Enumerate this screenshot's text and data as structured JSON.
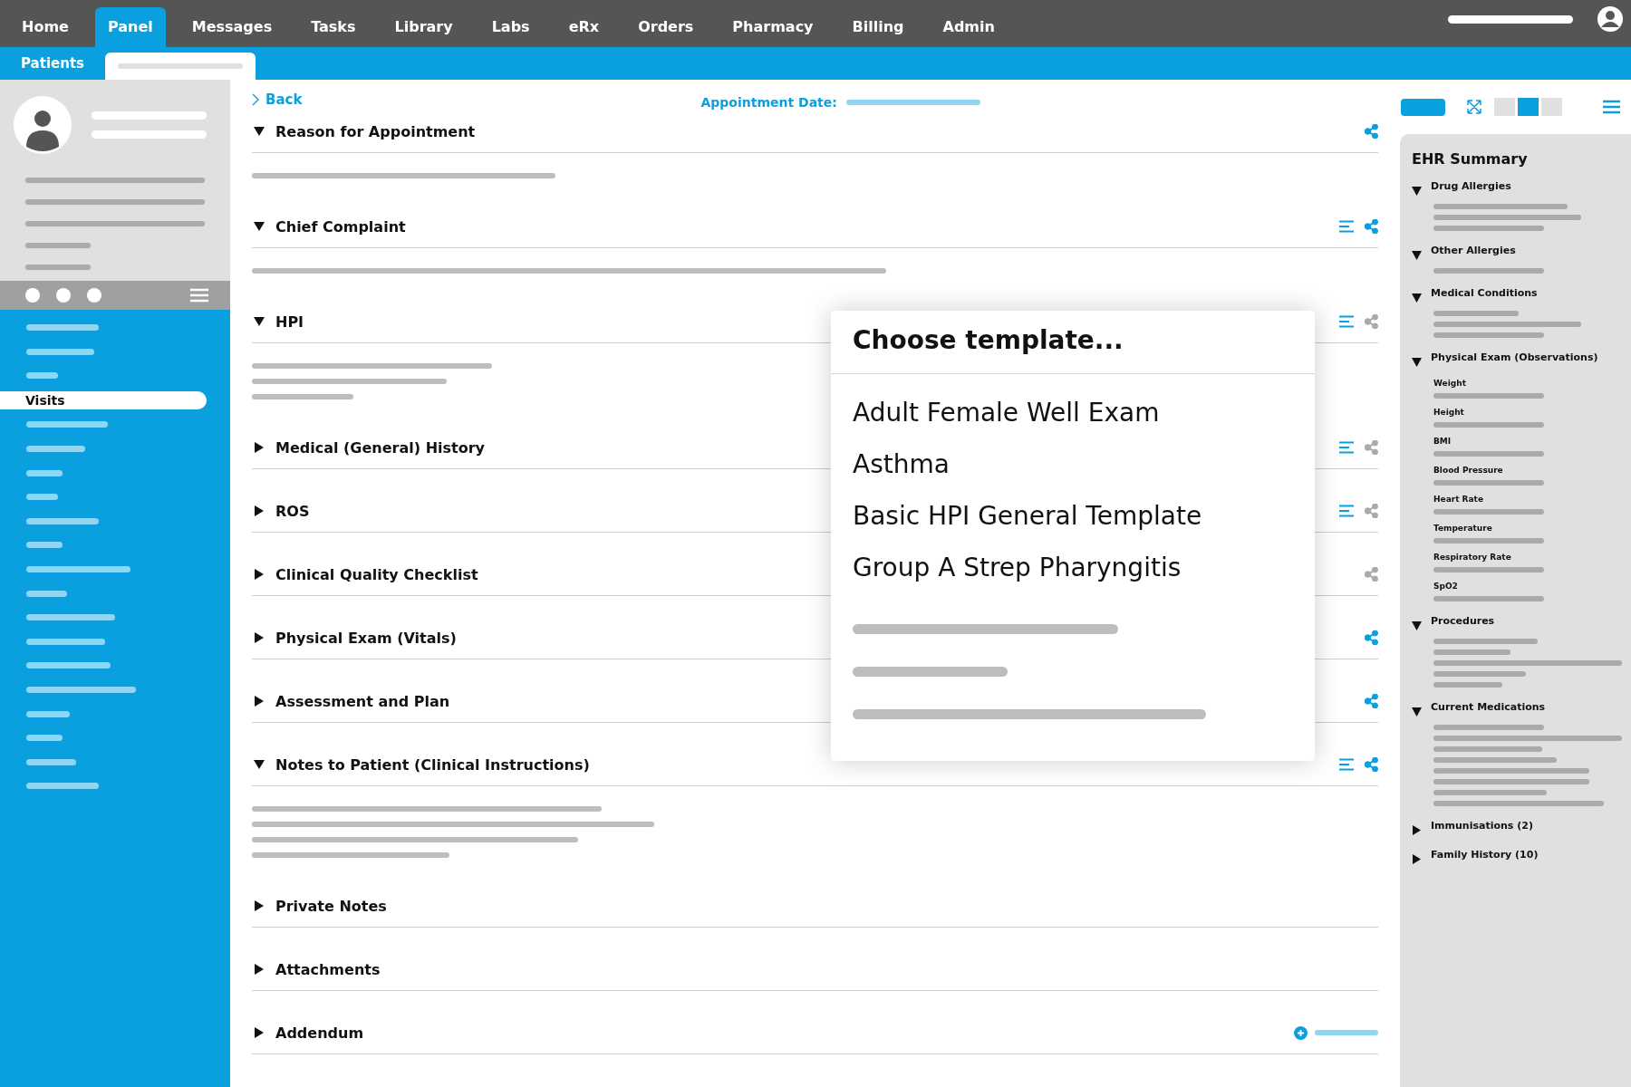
{
  "nav": {
    "items": [
      {
        "label": "Home",
        "selected": false
      },
      {
        "label": "Panel",
        "selected": true
      },
      {
        "label": "Messages",
        "selected": false
      },
      {
        "label": "Tasks",
        "selected": false
      },
      {
        "label": "Library",
        "selected": false
      },
      {
        "label": "Labs",
        "selected": false
      },
      {
        "label": "eRx",
        "selected": false
      },
      {
        "label": "Orders",
        "selected": false
      },
      {
        "label": "Pharmacy",
        "selected": false
      },
      {
        "label": "Billing",
        "selected": false
      },
      {
        "label": "Admin",
        "selected": false
      }
    ]
  },
  "subnav": {
    "tab": "Patients"
  },
  "sidebar": {
    "items": [
      {
        "label": "Visits",
        "selected": true
      }
    ]
  },
  "main": {
    "back": "Back",
    "appointment_label": "Appointment Date:",
    "sections": [
      {
        "title": "Reason for Appointment",
        "expanded": true,
        "template_icon": false,
        "share_icon": true,
        "share_enabled": true
      },
      {
        "title": "Chief Complaint",
        "expanded": true,
        "template_icon": true,
        "share_icon": true,
        "share_enabled": true
      },
      {
        "title": "HPI",
        "expanded": true,
        "template_icon": true,
        "share_icon": true,
        "share_enabled": false
      },
      {
        "title": "Medical (General) History",
        "expanded": false,
        "template_icon": true,
        "share_icon": true,
        "share_enabled": false
      },
      {
        "title": "ROS",
        "expanded": false,
        "template_icon": true,
        "share_icon": true,
        "share_enabled": false
      },
      {
        "title": "Clinical Quality Checklist",
        "expanded": false,
        "template_icon": false,
        "share_icon": true,
        "share_enabled": false
      },
      {
        "title": "Physical Exam (Vitals)",
        "expanded": false,
        "template_icon": false,
        "share_icon": true,
        "share_enabled": true
      },
      {
        "title": "Assessment and Plan",
        "expanded": false,
        "template_icon": false,
        "share_icon": true,
        "share_enabled": true
      },
      {
        "title": "Notes to Patient (Clinical Instructions)",
        "expanded": true,
        "template_icon": true,
        "share_icon": true,
        "share_enabled": true
      },
      {
        "title": "Private Notes",
        "expanded": false,
        "template_icon": false,
        "share_icon": false
      },
      {
        "title": "Attachments",
        "expanded": false,
        "template_icon": false,
        "share_icon": false
      },
      {
        "title": "Addendum",
        "expanded": false,
        "template_icon": false,
        "share_icon": false,
        "add_button": true
      }
    ]
  },
  "template_popup": {
    "title": "Choose template...",
    "options": [
      "Adult Female Well Exam",
      "Asthma",
      "Basic HPI General Template",
      "Group A Strep Pharyngitis"
    ]
  },
  "ehr_summary": {
    "title": "EHR Summary",
    "groups": [
      {
        "title": "Drug Allergies",
        "expanded": true
      },
      {
        "title": "Other Allergies",
        "expanded": true
      },
      {
        "title": "Medical Conditions",
        "expanded": true
      },
      {
        "title": "Physical Exam (Observations)",
        "expanded": true,
        "fields": [
          "Weight",
          "Height",
          "BMI",
          "Blood Pressure",
          "Heart Rate",
          "Temperature",
          "Respiratory Rate",
          "SpO2"
        ]
      },
      {
        "title": "Procedures",
        "expanded": true
      },
      {
        "title": "Current Medications",
        "expanded": true
      },
      {
        "title": "Immunisations (2)",
        "expanded": false
      },
      {
        "title": "Family History (10)",
        "expanded": false
      }
    ]
  }
}
